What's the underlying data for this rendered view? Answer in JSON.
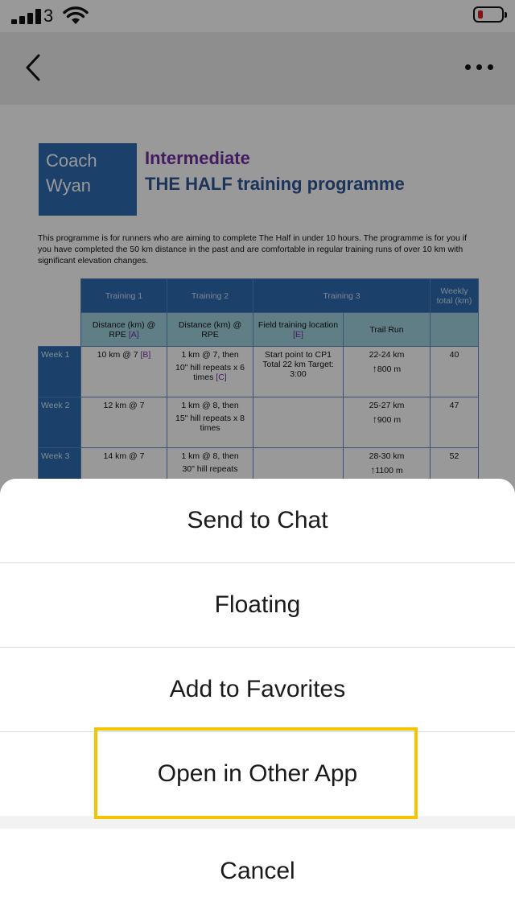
{
  "status_bar": {
    "carrier": "3"
  },
  "document": {
    "coach_line1": "Coach",
    "coach_line2": "Wyan",
    "title_line1": "Intermediate",
    "title_line2": "THE HALF training programme",
    "intro": "This programme is for runners who are aiming to complete The Half in under 10 hours.  The programme is for you if you have completed the 50 km distance in the past and are comfortable in regular training runs of over 10 km with significant elevation changes.",
    "table": {
      "headers": [
        "Training 1",
        "Training 2",
        "Training 3",
        "Weekly total (km)"
      ],
      "subheaders": {
        "training1": "Distance (km) @ RPE",
        "training1_ref": "[A]",
        "training2": "Distance (km) @ RPE",
        "field": "Field training location",
        "field_ref": "[E]",
        "trail": "Trail Run"
      },
      "rows": [
        {
          "week": "Week 1",
          "t1": "10 km @ 7",
          "t1_ref": "[B]",
          "t2a": "1 km @ 7, then",
          "t2b": "10\" hill repeats x 6 times",
          "t2_ref": "[C]",
          "field": "Start point to CP1 Total 22 km Target: 3:00",
          "trail": "22-24 km",
          "elev": "800 m",
          "total": "40"
        },
        {
          "week": "Week 2",
          "t1": "12 km @ 7",
          "t2a": "1 km @ 8, then",
          "t2b": "15\" hill repeats x 8 times",
          "field": "",
          "trail": "25-27 km",
          "elev": "900 m",
          "total": "47"
        },
        {
          "week": "Week 3",
          "t1": "14 km @ 7",
          "t2a": "1 km @ 8, then",
          "t2b": "30\" hill repeats",
          "field": "",
          "trail": "28-30 km",
          "elev": "1100 m",
          "total": "52"
        }
      ]
    }
  },
  "action_sheet": {
    "items": [
      "Send to Chat",
      "Floating",
      "Add to Favorites",
      "Open in Other App"
    ],
    "cancel": "Cancel",
    "highlight_color": "#f5c400"
  }
}
